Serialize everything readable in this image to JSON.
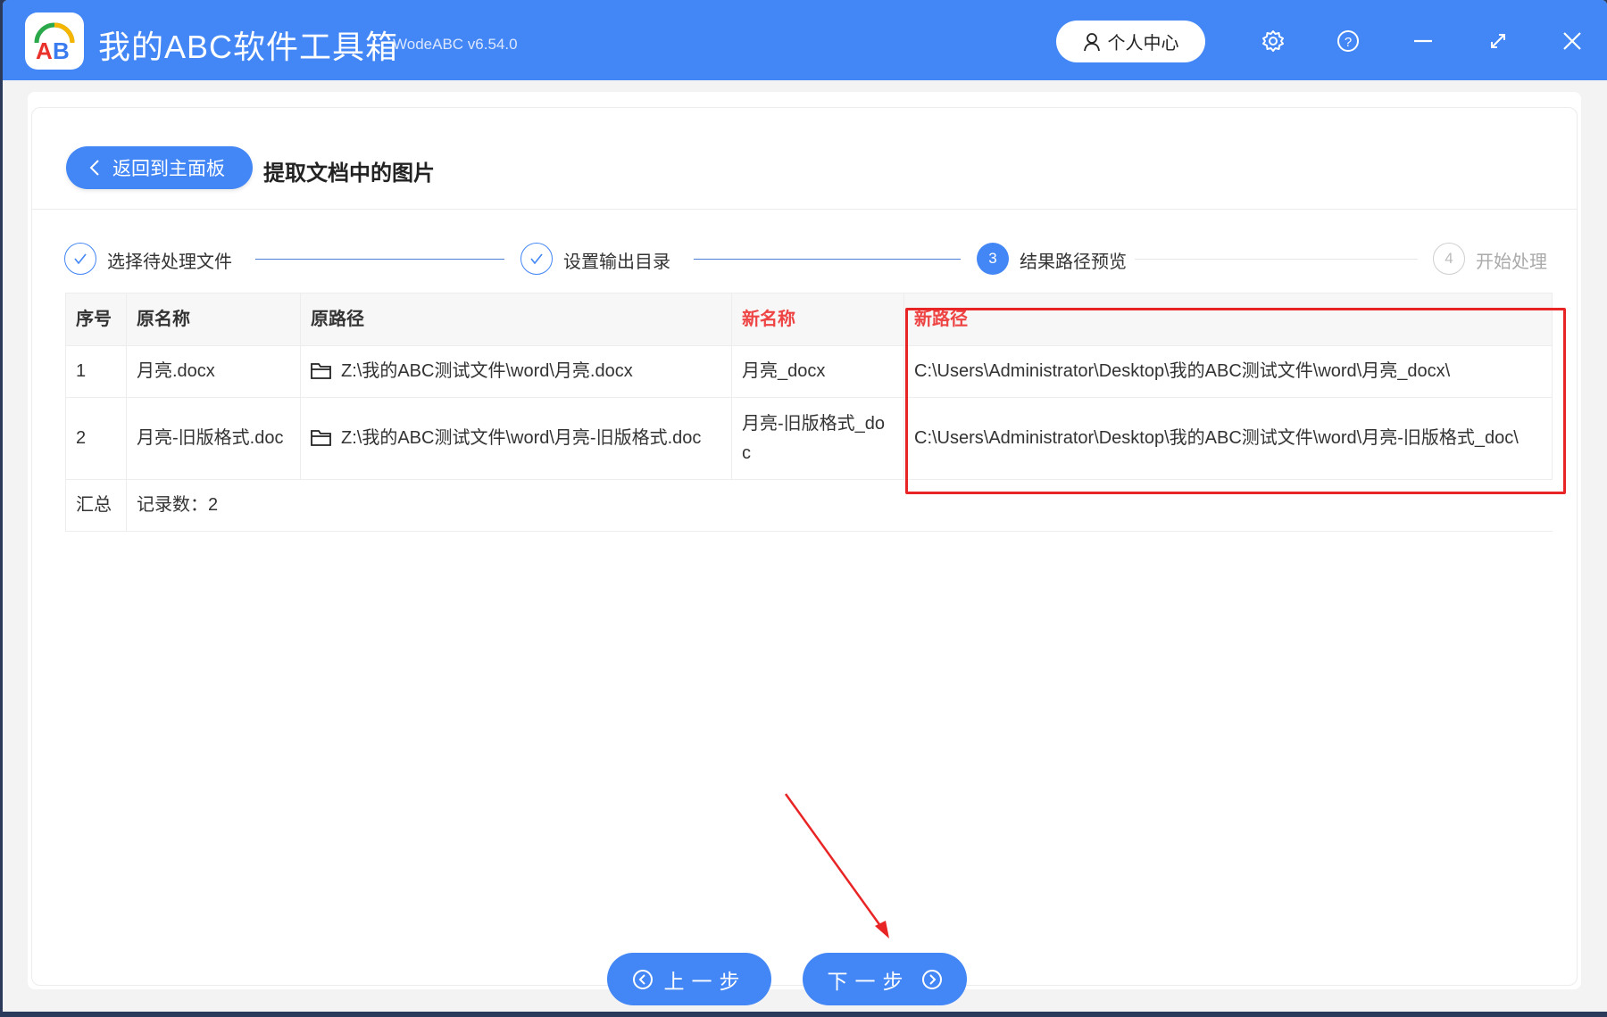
{
  "app": {
    "title": "我的ABC软件工具箱",
    "version": "WodeABC v6.54.0",
    "user_center": "个人中心"
  },
  "header": {
    "back_label": "返回到主面板",
    "page_title": "提取文档中的图片"
  },
  "steps": [
    {
      "label": "选择待处理文件",
      "state": "done"
    },
    {
      "label": "设置输出目录",
      "state": "done"
    },
    {
      "number": "3",
      "label": "结果路径预览",
      "state": "active"
    },
    {
      "number": "4",
      "label": "开始处理",
      "state": "pending"
    }
  ],
  "table": {
    "headers": [
      "序号",
      "原名称",
      "原路径",
      "新名称",
      "新路径"
    ],
    "rows": [
      {
        "index": "1",
        "name": "月亮.docx",
        "path": "Z:\\我的ABC测试文件\\word\\月亮.docx",
        "new_name": "月亮_docx",
        "new_path": "C:\\Users\\Administrator\\Desktop\\我的ABC测试文件\\word\\月亮_docx\\"
      },
      {
        "index": "2",
        "name": "月亮-旧版格式.doc",
        "path": "Z:\\我的ABC测试文件\\word\\月亮-旧版格式.doc",
        "new_name": "月亮-旧版格式_doc",
        "new_path": "C:\\Users\\Administrator\\Desktop\\我的ABC测试文件\\word\\月亮-旧版格式_doc\\"
      }
    ],
    "summary_label": "汇总",
    "summary_value": "记录数：2"
  },
  "footer": {
    "prev_label": "上一步",
    "next_label": "下一步"
  },
  "colors": {
    "primary": "#4386f5",
    "highlight": "#e82424",
    "header_red": "#ee4444"
  }
}
